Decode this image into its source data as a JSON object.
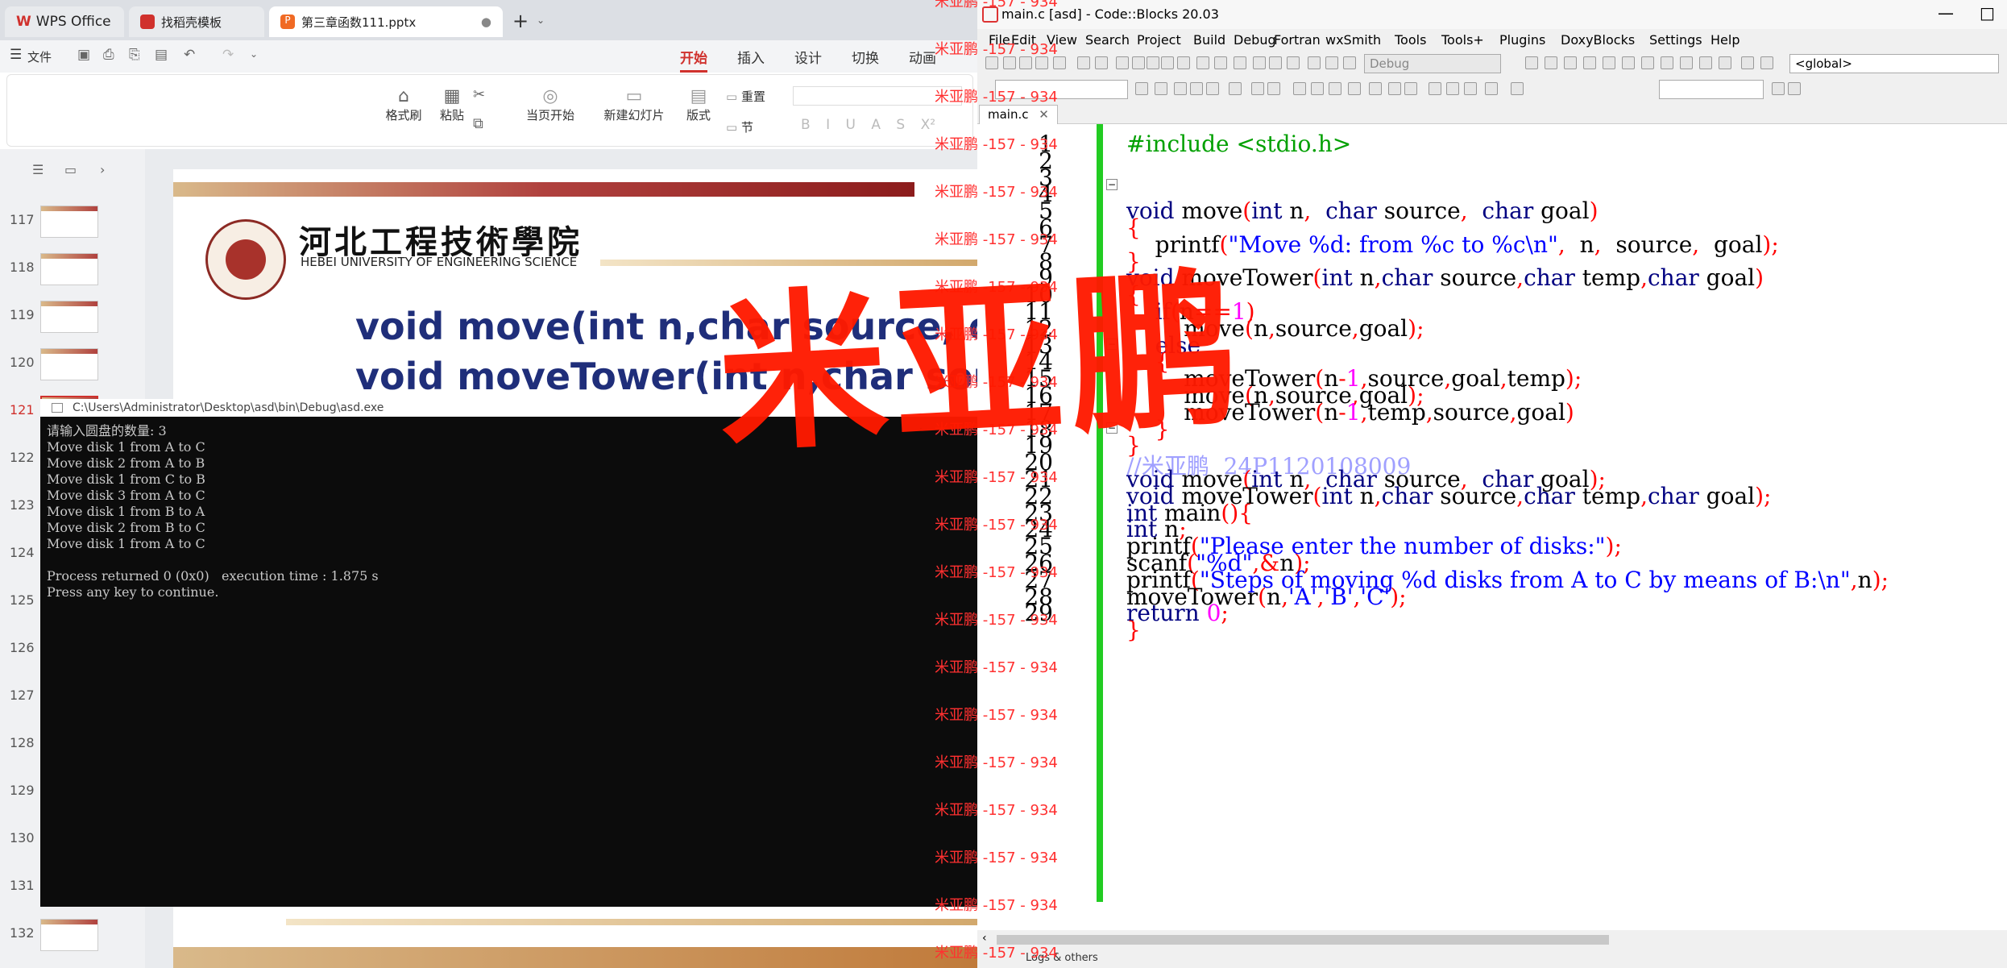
{
  "wps": {
    "tabs": [
      {
        "label": "WPS Office",
        "color": "#d0312d"
      },
      {
        "label": "找稻壳模板",
        "color": "#d0312d"
      },
      {
        "label": "第三章函数111.pptx",
        "color": "#f06a24"
      }
    ],
    "menu_file": "文件",
    "ribbon_tabs": [
      "开始",
      "插入",
      "设计",
      "切换",
      "动画"
    ],
    "ribbon_active": "开始",
    "ribbon_buttons": [
      {
        "label": "格式刷",
        "icon": "format-painter-icon"
      },
      {
        "label": "粘贴",
        "icon": "paste-icon"
      },
      {
        "label": "当页开始",
        "icon": "play-icon"
      },
      {
        "label": "新建幻灯片",
        "icon": "new-slide-icon"
      },
      {
        "label": "版式",
        "icon": "layout-icon"
      },
      {
        "label": "节",
        "icon": "section-icon"
      },
      {
        "label": "重置",
        "icon": "reset-icon"
      }
    ],
    "format_letters": [
      "B",
      "I",
      "U",
      "A",
      "S",
      "X²"
    ],
    "slide_numbers": [
      "117",
      "118",
      "119",
      "120",
      "121",
      "122",
      "123",
      "124",
      "125",
      "126",
      "127",
      "128",
      "129",
      "130",
      "131",
      "132"
    ],
    "slide": {
      "school_cn": "河北工程技術學院",
      "school_en": "HEBEI UNIVERSITY OF ENGINEERING SCIENCE",
      "line1": "void move(int n,char source, cha",
      "line2": "void moveTower(int n,char sour"
    }
  },
  "console": {
    "title": "C:\\Users\\Administrator\\Desktop\\asd\\bin\\Debug\\asd.exe",
    "lines": [
      "请输入圆盘的数量: 3",
      "Move disk 1 from A to C",
      "Move disk 2 from A to B",
      "Move disk 1 from C to B",
      "Move disk 3 from A to C",
      "Move disk 1 from B to A",
      "Move disk 2 from B to C",
      "Move disk 1 from A to C",
      "",
      "Process returned 0 (0x0)   execution time : 1.875 s",
      "Press any key to continue."
    ]
  },
  "codeblocks": {
    "title": "main.c [asd] - Code::Blocks 20.03",
    "menu": [
      "File",
      "Edit",
      "View",
      "Search",
      "Project",
      "Build",
      "Debug",
      "Fortran",
      "wxSmith",
      "Tools",
      "Tools+",
      "Plugins",
      "DoxyBlocks",
      "Settings",
      "Help"
    ],
    "build_target": "Debug",
    "scope": "<global>",
    "file_tab": "main.c",
    "line_numbers": [
      "1",
      "2",
      "3",
      "4",
      "5",
      "6",
      "7",
      "8",
      "9",
      "10",
      "11",
      "12",
      "13",
      "14",
      "15",
      "16",
      "17",
      "18",
      "19",
      "20",
      "21",
      "22",
      "23",
      "24",
      "25",
      "26",
      "27",
      "28",
      "29"
    ],
    "comment": "//米亚鹏  24P1120108009",
    "status": "Logs & others"
  },
  "watermark": {
    "big": "米亚鹏",
    "tile": "米亚鹏 -157 - 934"
  }
}
